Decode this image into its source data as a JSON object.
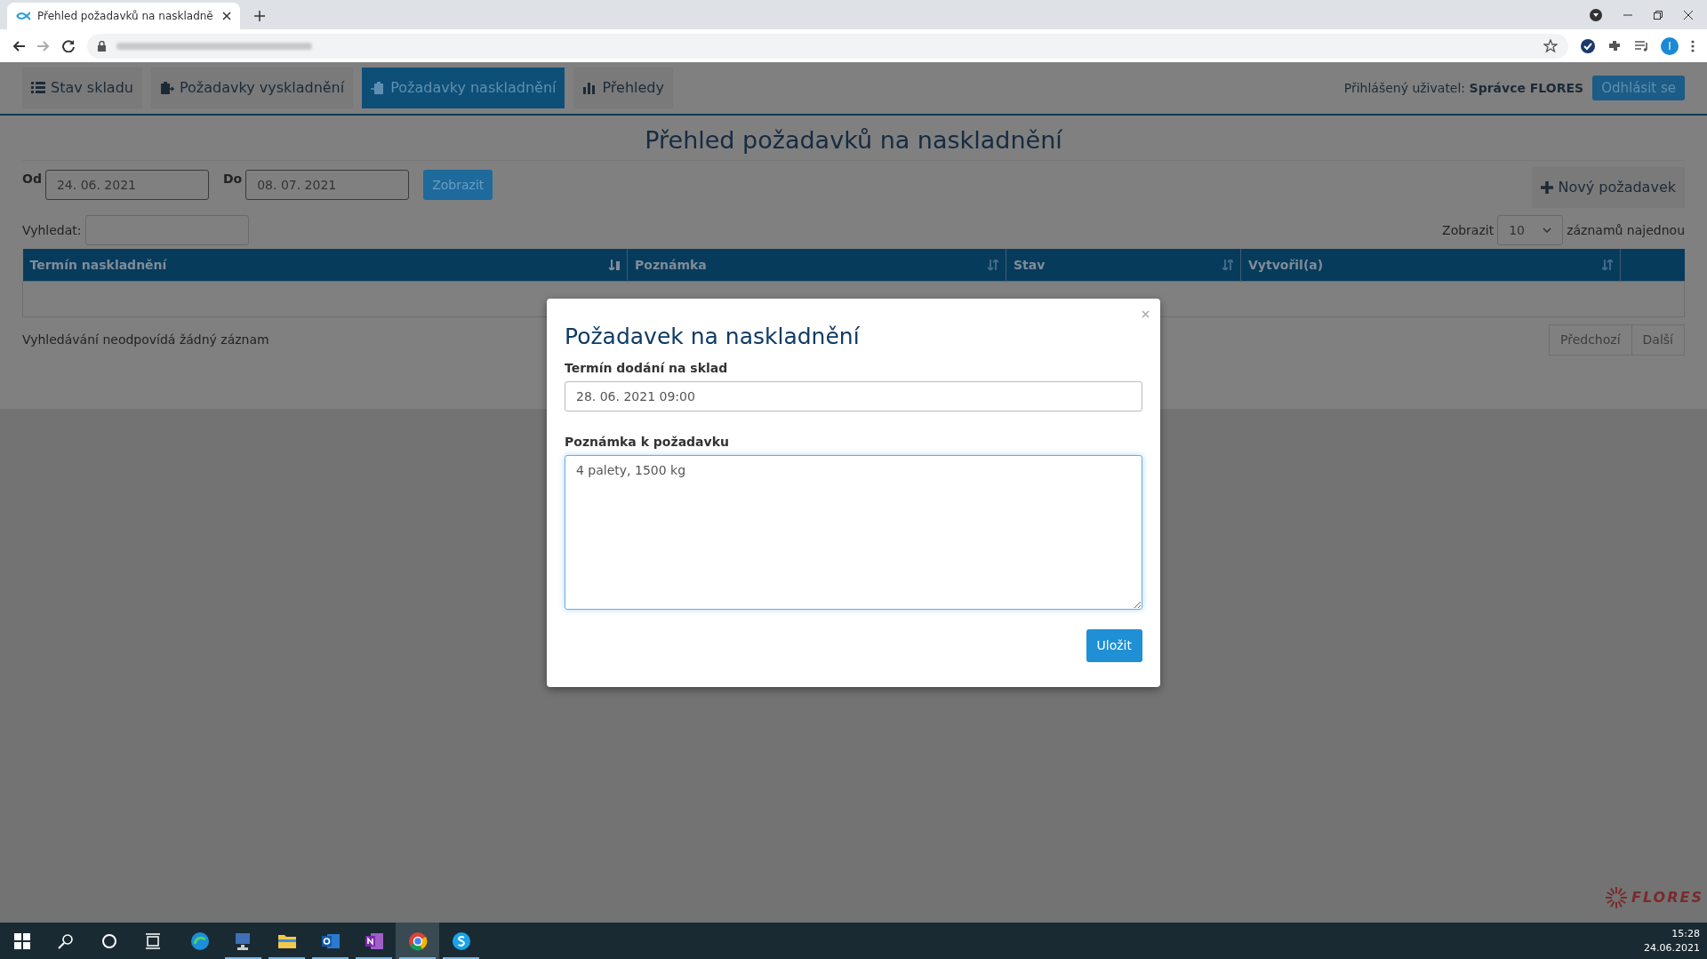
{
  "browser": {
    "tab_title": "Přehled požadavků na naskladně",
    "profile_initial": "I"
  },
  "nav": {
    "tabs": [
      {
        "label": "Stav skladu",
        "kind": "list",
        "selected": false
      },
      {
        "label": "Požadavky vyskladnění",
        "kind": "clipboard-out",
        "selected": false
      },
      {
        "label": "Požadavky naskladnění",
        "kind": "clipboard-in",
        "selected": true
      },
      {
        "label": "Přehledy",
        "kind": "chart",
        "selected": false
      }
    ],
    "user_label": "Přihlášený uživatel:",
    "user_name": "Správce FLORES",
    "logout": "Odhlásit se"
  },
  "title": "Přehled požadavků na naskladnění",
  "filters": {
    "from_label": "Od",
    "from_value": "24. 06. 2021",
    "to_label": "Do",
    "to_value": "08. 07. 2021",
    "show_button": "Zobrazit"
  },
  "new_button": "Nový požadavek",
  "search_label": "Vyhledat:",
  "page_length": {
    "prefix": "Zobrazit",
    "value": "10",
    "suffix": "záznamů najednou"
  },
  "table": {
    "columns": [
      {
        "label": "Termín naskladnění",
        "sorted": true
      },
      {
        "label": "Poznámka",
        "sorted": false
      },
      {
        "label": "Stav",
        "sorted": false
      },
      {
        "label": "Vytvořil(a)",
        "sorted": false
      }
    ]
  },
  "info": "Vyhledávání neodpovídá žádný záznam",
  "pagination": [
    {
      "label": "Předchozí",
      "disabled": true
    },
    {
      "label": "Další",
      "disabled": true
    }
  ],
  "modal": {
    "title": "Požadavek na naskladnění",
    "date_label": "Termín dodání na sklad",
    "date_value": "28. 06. 2021 09:00",
    "note_label": "Poznámka k požadavku",
    "note_value": "4 palety, 1500 kg",
    "save": "Uložit"
  },
  "logo": "FLORES",
  "taskbar": {
    "apps": [
      {
        "kind": "edge",
        "running": false,
        "selected": false
      },
      {
        "kind": "remote",
        "running": true,
        "selected": false
      },
      {
        "kind": "folder",
        "running": true,
        "selected": false
      },
      {
        "kind": "outlook",
        "running": true,
        "selected": false
      },
      {
        "kind": "onenote",
        "running": true,
        "selected": false
      },
      {
        "kind": "chrome",
        "running": true,
        "selected": true
      },
      {
        "kind": "skype",
        "running": true,
        "selected": false
      }
    ],
    "time": "15:28",
    "date": "24.06.2021"
  }
}
